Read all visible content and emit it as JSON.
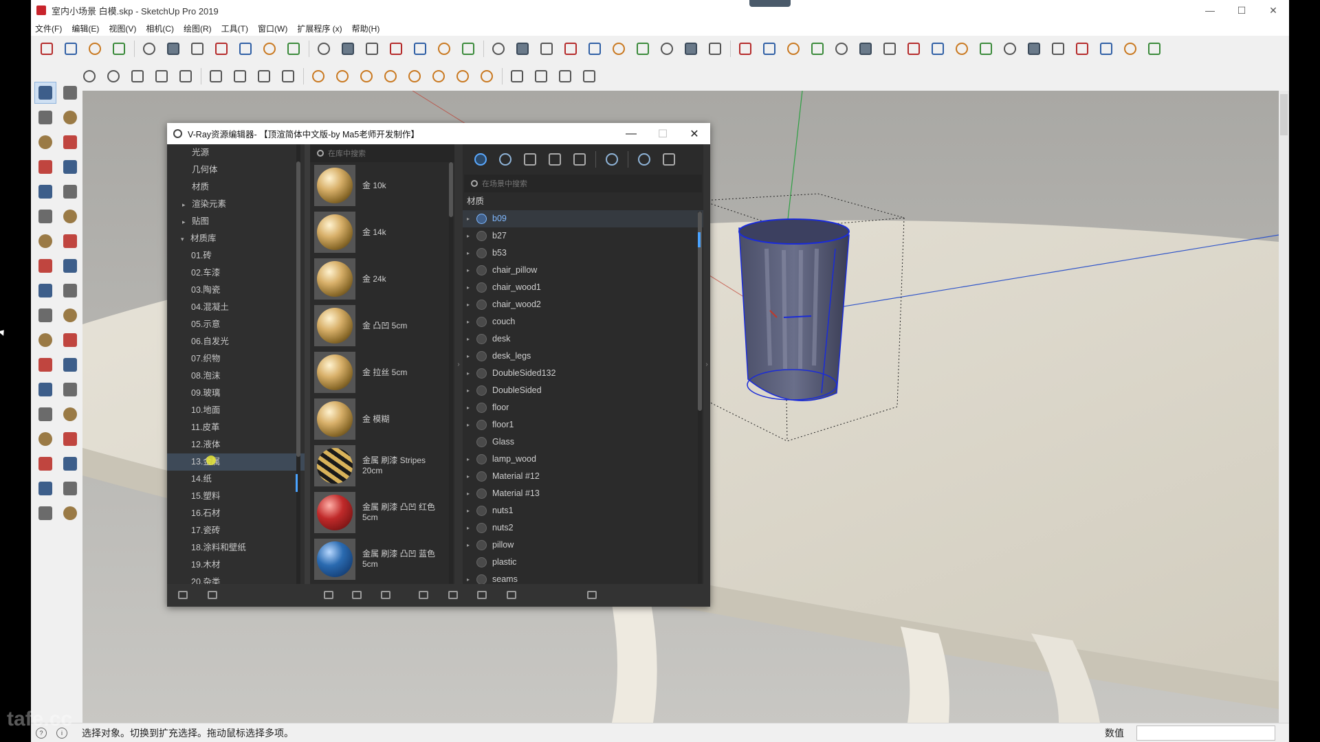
{
  "app": {
    "title": "室内小场景 白模.skp - SketchUp Pro 2019",
    "win_buttons": [
      "—",
      "☐",
      "✕"
    ]
  },
  "menu": [
    "文件(F)",
    "编辑(E)",
    "视图(V)",
    "相机(C)",
    "绘图(R)",
    "工具(T)",
    "窗口(W)",
    "扩展程序 (x)",
    "帮助(H)"
  ],
  "toolbar_row1": [
    "new-file",
    "open-file",
    "save-file",
    "cut",
    "paint-bucket",
    "eraser-doc",
    "no-entry",
    "undo",
    "redo",
    "print",
    "vray-render",
    "house-top",
    "house-front",
    "house",
    "house-open",
    "house-outline",
    "house-side",
    "mirror",
    "shield",
    "pin",
    "leaf",
    "cube-solid",
    "cube-wire",
    "cube-edge",
    "plane",
    "shaded",
    "layers",
    "cube-blue",
    "arc-1",
    "line-n",
    "curve-z",
    "curve-n",
    "line-i",
    "arc-green",
    "square",
    "circle-o",
    "arc-c",
    "zigzag",
    "arc-r",
    "arc-s",
    "arc-red",
    "line-v",
    "polygon",
    "wrench",
    "circle",
    "arc-left"
  ],
  "toolbar_row2": [
    "vray-logo",
    "teapot",
    "teapot-2",
    "render-region",
    "frame-buffer",
    "frame",
    "frame-2",
    "frame-3",
    "lock-frame",
    "light-spot",
    "light-sphere",
    "light-plane",
    "light-omni",
    "light-sun",
    "light-dome",
    "light-mesh",
    "vray-proxy",
    "cube-box",
    "cube-mesh",
    "grass",
    "scatter"
  ],
  "left_tools": [
    "select",
    "component",
    "paint",
    "eraser",
    "pencil",
    "freehand",
    "rectangle",
    "rotated-rect",
    "circle",
    "polygon",
    "arc",
    "pie",
    "arc-3pt",
    "arc-2pt",
    "push-pull",
    "follow-me",
    "move",
    "rotate",
    "scale",
    "offset",
    "tape",
    "dimension",
    "protractor",
    "text",
    "axes",
    "3d-text",
    "orbit",
    "pan",
    "zoom",
    "zoom-window",
    "zoom-extents",
    "previous",
    "position-camera",
    "look-around",
    "walk",
    "section"
  ],
  "vray": {
    "title": "V-Ray资源编辑器- 【顶渲简体中文版-by Ma5老师开发制作】",
    "tree": [
      {
        "label": "光源",
        "level": 1
      },
      {
        "label": "几何体",
        "level": 1
      },
      {
        "label": "材质",
        "level": 1
      },
      {
        "label": "渲染元素",
        "level": 1,
        "arrow": "▸"
      },
      {
        "label": "贴图",
        "level": 1,
        "arrow": "▸"
      },
      {
        "label": "材质库",
        "level": 0,
        "arrow": "▾"
      },
      {
        "label": "01.砖",
        "level": 2
      },
      {
        "label": "02.车漆",
        "level": 2
      },
      {
        "label": "03.陶瓷",
        "level": 2
      },
      {
        "label": "04.混凝土",
        "level": 2
      },
      {
        "label": "05.示意",
        "level": 2
      },
      {
        "label": "06.自发光",
        "level": 2
      },
      {
        "label": "07.织物",
        "level": 2
      },
      {
        "label": "08.泡沫",
        "level": 2
      },
      {
        "label": "09.玻璃",
        "level": 2
      },
      {
        "label": "10.地面",
        "level": 2
      },
      {
        "label": "11.皮革",
        "level": 2
      },
      {
        "label": "12.液体",
        "level": 2
      },
      {
        "label": "13.金属",
        "level": 2,
        "highlight": true
      },
      {
        "label": "14.纸",
        "level": 2
      },
      {
        "label": "15.塑料",
        "level": 2
      },
      {
        "label": "16.石材",
        "level": 2
      },
      {
        "label": "17.瓷砖",
        "level": 2
      },
      {
        "label": "18.涂料和壁纸",
        "level": 2
      },
      {
        "label": "19.木材",
        "level": 2
      },
      {
        "label": "20.杂类",
        "level": 2
      }
    ],
    "lib_search_placeholder": "在库中搜索",
    "library": [
      {
        "name": "金 10k",
        "swatch": "gold"
      },
      {
        "name": "金 14k",
        "swatch": "gold"
      },
      {
        "name": "金 24k",
        "swatch": "gold"
      },
      {
        "name": "金 凸凹 5cm",
        "swatch": "gold"
      },
      {
        "name": "金 拉丝 5cm",
        "swatch": "gold"
      },
      {
        "name": "金 模糊",
        "swatch": "gold"
      },
      {
        "name": "金属 刷漆 Stripes 20cm",
        "swatch": "stripe"
      },
      {
        "name": "金属 刷漆 凸凹 红色 5cm",
        "swatch": "red"
      },
      {
        "name": "金属 刷漆 凸凹 蓝色 5cm",
        "swatch": "blue"
      }
    ],
    "scene_search_placeholder": "在场景中搜索",
    "scene_category": "材质",
    "materials": [
      {
        "name": "b09",
        "selected": true,
        "arrow": true
      },
      {
        "name": "b27",
        "arrow": true
      },
      {
        "name": "b53",
        "arrow": true
      },
      {
        "name": "chair_pillow",
        "arrow": true
      },
      {
        "name": "chair_wood1",
        "arrow": true
      },
      {
        "name": "chair_wood2",
        "arrow": true
      },
      {
        "name": "couch",
        "arrow": true
      },
      {
        "name": "desk",
        "arrow": true
      },
      {
        "name": "desk_legs",
        "arrow": true
      },
      {
        "name": "DoubleSided132",
        "arrow": true
      },
      {
        "name": "DoubleSided",
        "arrow": true
      },
      {
        "name": "floor",
        "arrow": true
      },
      {
        "name": "floor1",
        "arrow": true
      },
      {
        "name": "Glass",
        "arrow": false
      },
      {
        "name": "lamp_wood",
        "arrow": true
      },
      {
        "name": "Material #12",
        "arrow": true
      },
      {
        "name": "Material #13",
        "arrow": true
      },
      {
        "name": "nuts1",
        "arrow": true
      },
      {
        "name": "nuts2",
        "arrow": true
      },
      {
        "name": "pillow",
        "arrow": true
      },
      {
        "name": "plastic",
        "arrow": false
      },
      {
        "name": "seams",
        "arrow": true
      }
    ]
  },
  "status": {
    "message": "选择对象。切换到扩充选择。拖动鼠标选择多项。",
    "value_label": "数值"
  },
  "watermark": "tafe.cc",
  "colors": {
    "accent_blue": "#4aa3ff",
    "selection_blue": "#7fb8ff",
    "dialog_bg": "#2b2b2b",
    "axis_red": "#c0392b",
    "axis_green": "#2ea043",
    "axis_blue": "#2f54c9"
  }
}
